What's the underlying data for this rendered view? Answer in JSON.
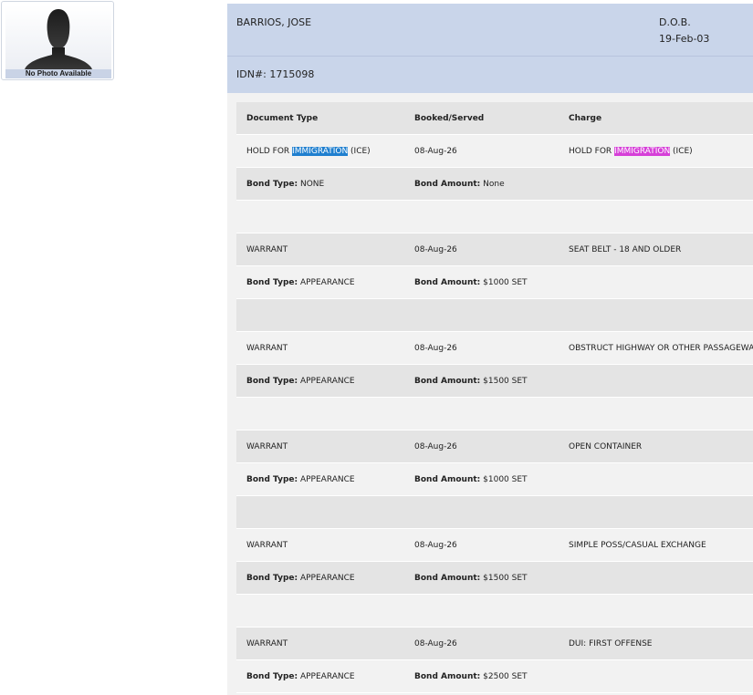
{
  "photo": {
    "caption": "No Photo Available"
  },
  "inmate": {
    "name": "BARRIOS, JOSE",
    "dob_label": "D.O.B.",
    "dob": "19-Feb-03",
    "idn": "IDN#: 1715098"
  },
  "table": {
    "headers": {
      "doc_type": "Document Type",
      "booked": "Booked/Served",
      "charge": "Charge"
    },
    "bond_type_label": "Bond Type:",
    "bond_amount_label": "Bond Amount:",
    "first_entry": {
      "doc_pre": "HOLD FOR ",
      "doc_hl": "IMMIGRATION",
      "doc_post": " (ICE)",
      "booked": "08-Aug-26",
      "charge_pre": "HOLD FOR ",
      "charge_hl": "IMMIGRATION",
      "charge_post": " (ICE)",
      "bond_type": " NONE",
      "bond_amount": " None"
    },
    "entries": [
      {
        "doc": "WARRANT",
        "booked": "08-Aug-26",
        "charge": "SEAT BELT - 18 AND OLDER",
        "bond_type": " APPEARANCE",
        "bond_amount": " $1000 SET"
      },
      {
        "doc": "WARRANT",
        "booked": "08-Aug-26",
        "charge": "OBSTRUCT HIGHWAY OR OTHER PASSAGEWAY",
        "bond_type": " APPEARANCE",
        "bond_amount": " $1500 SET"
      },
      {
        "doc": "WARRANT",
        "booked": "08-Aug-26",
        "charge": "OPEN CONTAINER",
        "bond_type": " APPEARANCE",
        "bond_amount": " $1000 SET"
      },
      {
        "doc": "WARRANT",
        "booked": "08-Aug-26",
        "charge": "SIMPLE POSS/CASUAL EXCHANGE",
        "bond_type": " APPEARANCE",
        "bond_amount": " $1500 SET"
      },
      {
        "doc": "WARRANT",
        "booked": "08-Aug-26",
        "charge": "DUI: FIRST OFFENSE",
        "bond_type": " APPEARANCE",
        "bond_amount": " $2500 SET"
      }
    ]
  },
  "colors": {
    "header_bg": "#c9d5ea",
    "row_dark": "#e4e4e4",
    "row_light": "#f2f2f2",
    "highlight_blue": "#1f7fcf",
    "highlight_pink": "#d63fd8"
  }
}
